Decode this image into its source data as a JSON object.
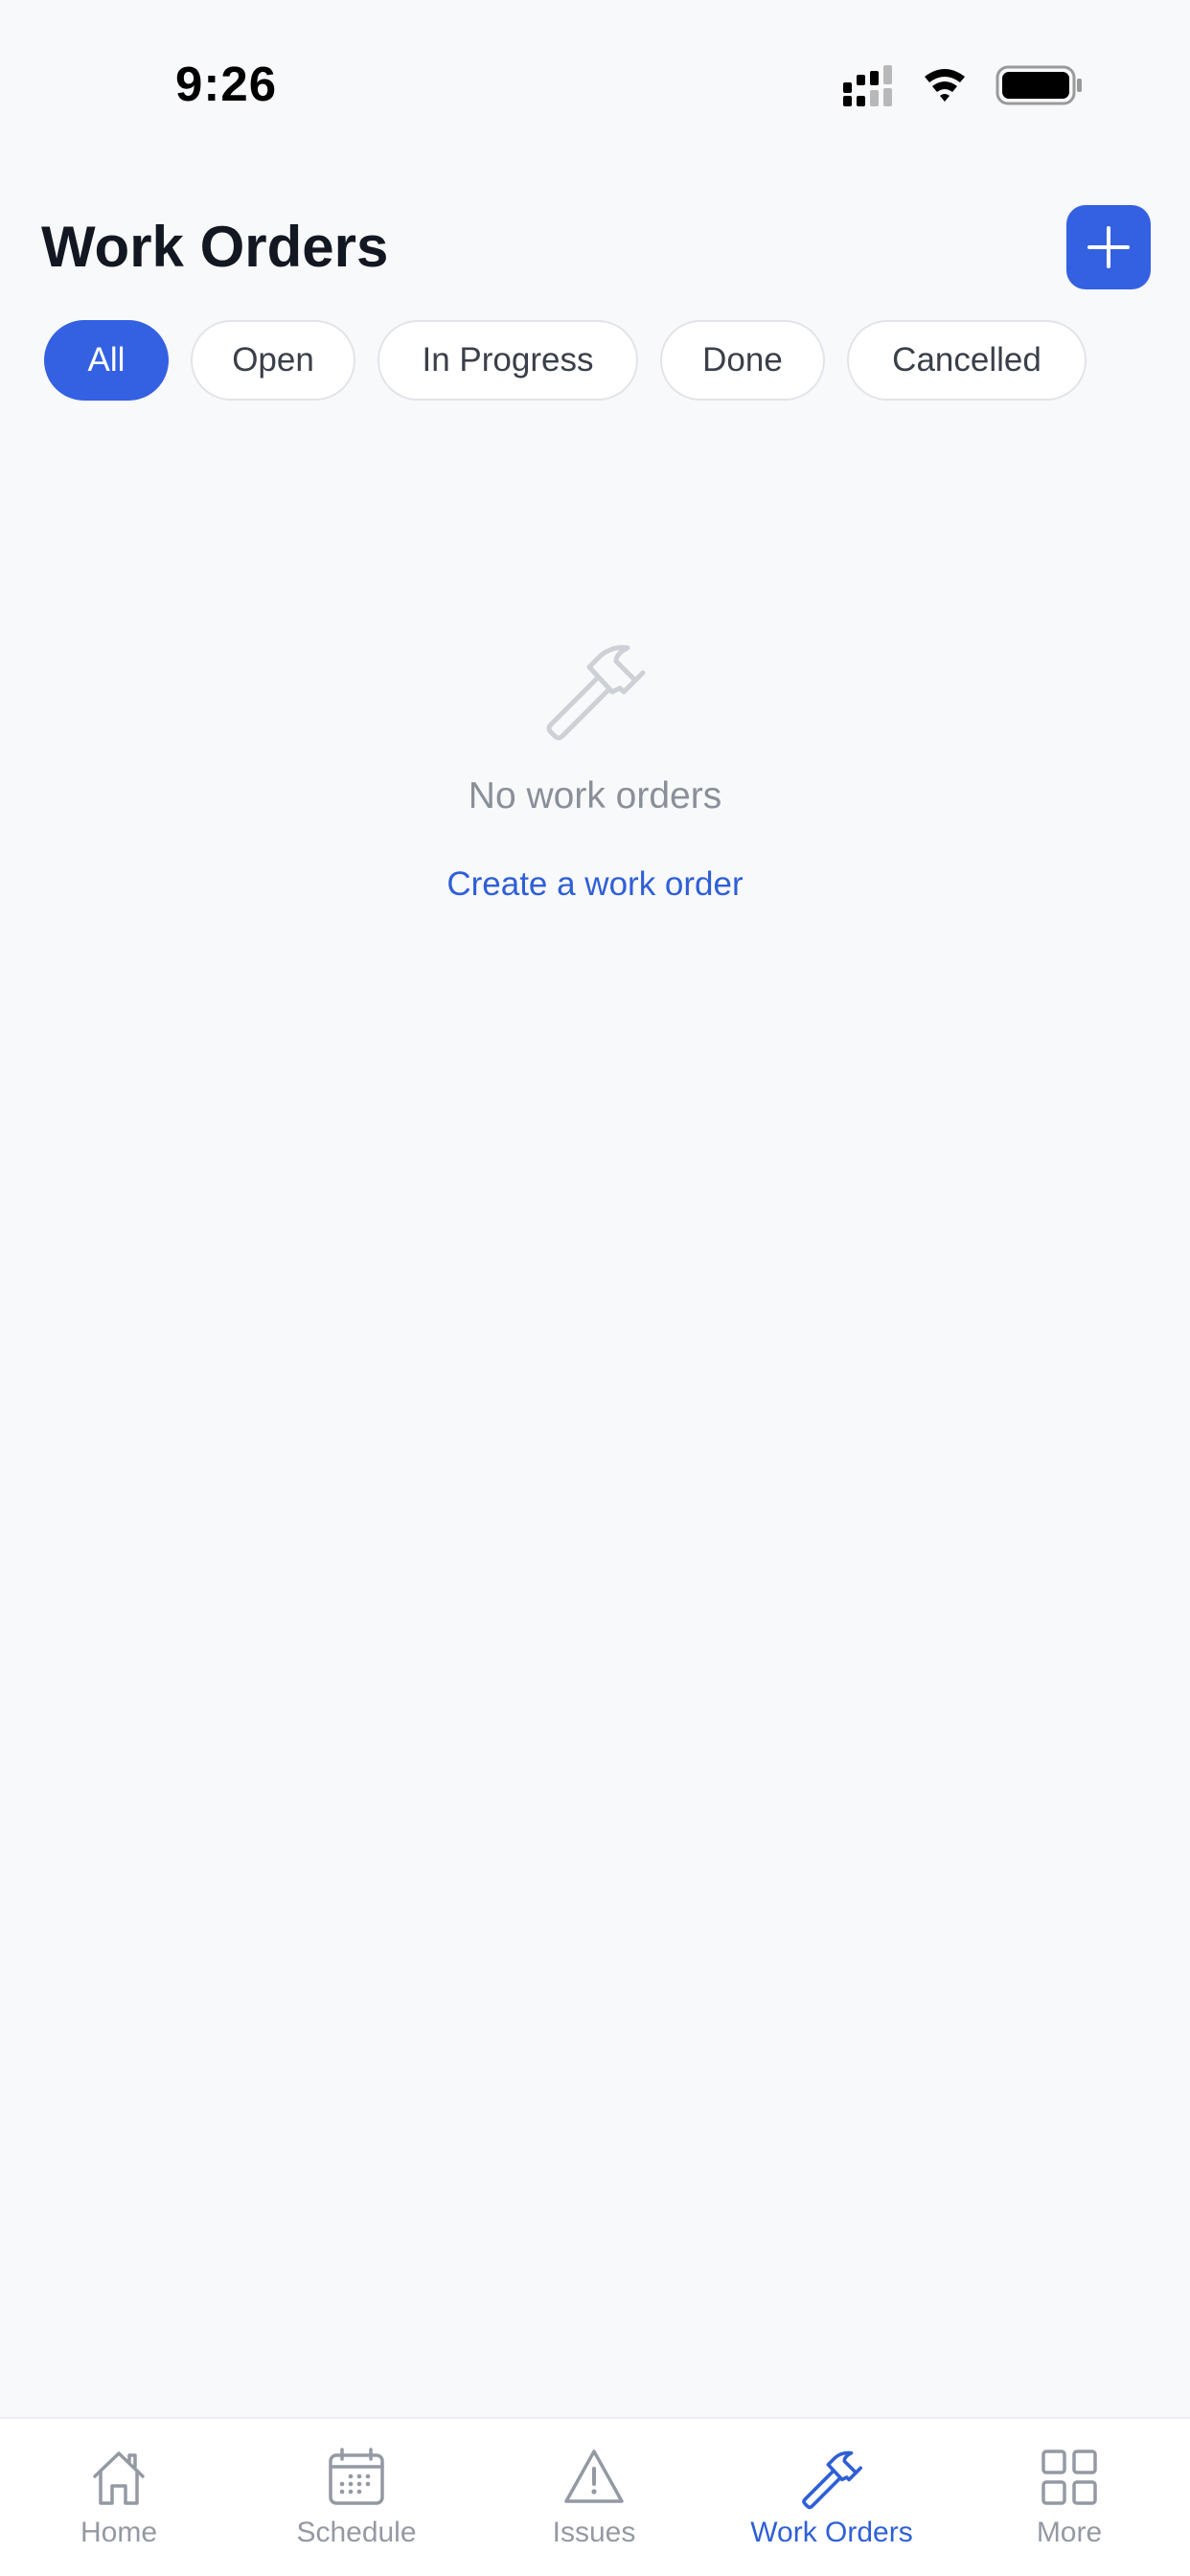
{
  "status_bar": {
    "time": "9:26"
  },
  "header": {
    "title": "Work Orders",
    "add_icon": "plus-icon"
  },
  "filters": [
    {
      "label": "All",
      "active": true
    },
    {
      "label": "Open",
      "active": false
    },
    {
      "label": "In Progress",
      "active": false
    },
    {
      "label": "Done",
      "active": false
    },
    {
      "label": "Cancelled",
      "active": false
    }
  ],
  "empty_state": {
    "icon": "hammer-icon",
    "message": "No work orders",
    "action_label": "Create a work order"
  },
  "tab_bar": {
    "items": [
      {
        "label": "Home",
        "icon": "home-icon",
        "active": false
      },
      {
        "label": "Schedule",
        "icon": "calendar-icon",
        "active": false
      },
      {
        "label": "Issues",
        "icon": "warning-icon",
        "active": false
      },
      {
        "label": "Work Orders",
        "icon": "hammer-icon",
        "active": true
      },
      {
        "label": "More",
        "icon": "grid-icon",
        "active": false
      }
    ]
  },
  "colors": {
    "accent": "#3461e2",
    "link": "#2f5fd6",
    "background": "#f8f9fb",
    "muted_text": "#8a8f99",
    "inactive_tab": "#9499a3"
  }
}
